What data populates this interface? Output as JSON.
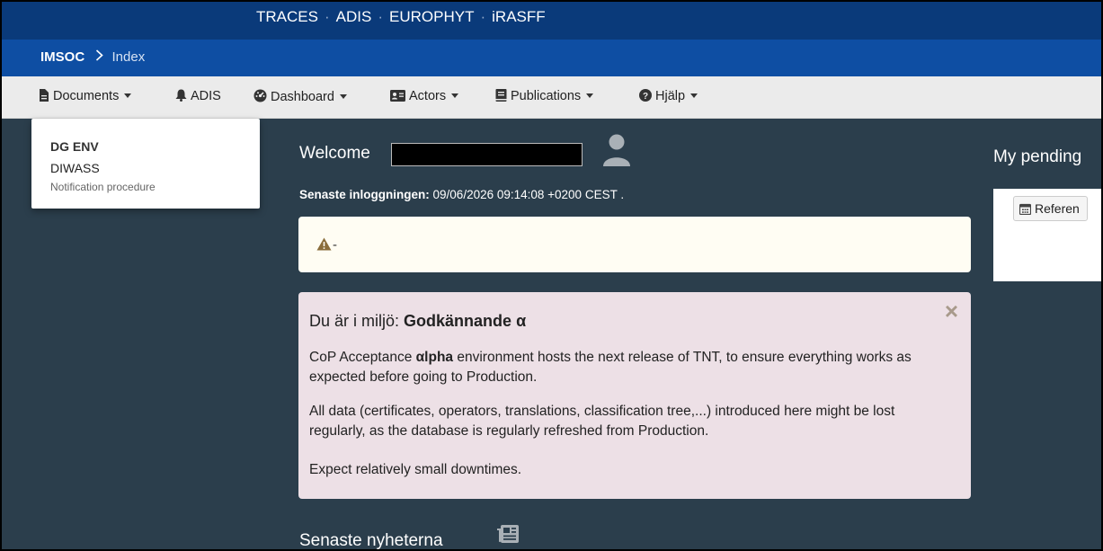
{
  "topbar": {
    "apps": [
      "TRACES",
      "ADIS",
      "EUROPHYT",
      "iRASFF"
    ],
    "separator": "·"
  },
  "breadcrumb": {
    "brand": "IMSOC",
    "current": "Index"
  },
  "menu": {
    "documents": "Documents",
    "adis": "ADIS",
    "dashboard": "Dashboard",
    "actors": "Actors",
    "publications": "Publications",
    "help": "Hjälp"
  },
  "dropdown": {
    "header": "DG ENV",
    "item": "DIWASS",
    "sub": "Notification procedure"
  },
  "welcome": {
    "label": "Welcome",
    "last_login_label": "Senaste inloggningen:",
    "last_login_value": "09/06/2026 09:14:08 +0200 CEST ."
  },
  "warning": {
    "text": "-"
  },
  "environment": {
    "title_prefix": "Du är i miljö:",
    "title_env": "Godkännande α",
    "p1_prefix": "CoP Acceptance ",
    "p1_bold": "αlpha",
    "p1_rest": " environment hosts the next release of TNT, to ensure everything works as expected before going to Production.",
    "p2": "All data (certificates, operators, translations, classification tree,...) introduced here might be lost regularly, as the database is regularly refreshed from Production.",
    "p3": "Expect relatively small downtimes.",
    "close": "×"
  },
  "news": {
    "title": "Senaste nyheterna"
  },
  "pending": {
    "title": "My pending",
    "reference_button": "Referen"
  },
  "icons": {
    "documents": "file-icon",
    "adis": "bell-icon",
    "dashboard": "dashboard-icon",
    "actors": "id-card-icon",
    "publications": "book-icon",
    "help": "question-circle-icon",
    "user": "user-icon",
    "warning": "warning-triangle-icon",
    "news": "newspaper-icon",
    "calendar": "calendar-icon"
  },
  "colors": {
    "topbar": "#0a3a7a",
    "crumbbar": "#0e4ea3",
    "background": "#2b3e4c",
    "env_box": "#ede0e6",
    "warning_box": "#fffdf3"
  }
}
